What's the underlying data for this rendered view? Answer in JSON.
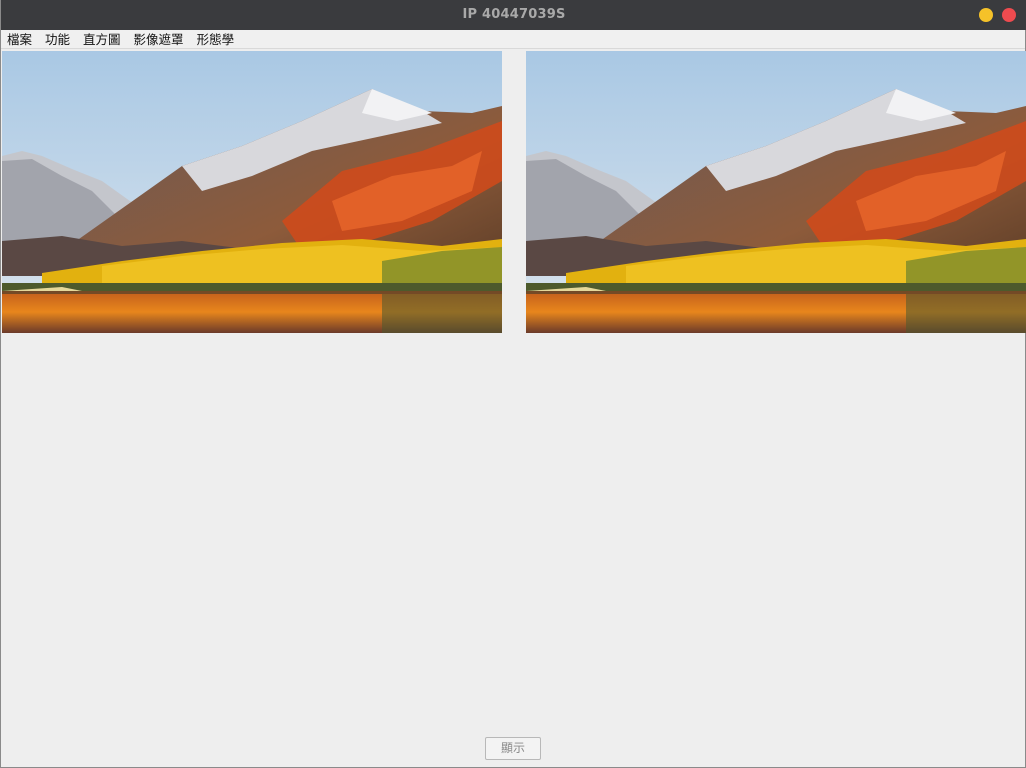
{
  "window": {
    "title": "IP 40447039S"
  },
  "menu": {
    "items": [
      {
        "label": "檔案"
      },
      {
        "label": "功能"
      },
      {
        "label": "直方圖"
      },
      {
        "label": "影像遮罩"
      },
      {
        "label": "形態學"
      }
    ]
  },
  "images": {
    "left": {
      "description_icon": "landscape-photo"
    },
    "right": {
      "description_icon": "landscape-photo"
    }
  },
  "footer": {
    "show_button_label": "顯示"
  },
  "colors": {
    "titlebar": "#3a3b3e",
    "minimize": "#f5c229",
    "close": "#ee4b4f",
    "background": "#eeeeee"
  }
}
